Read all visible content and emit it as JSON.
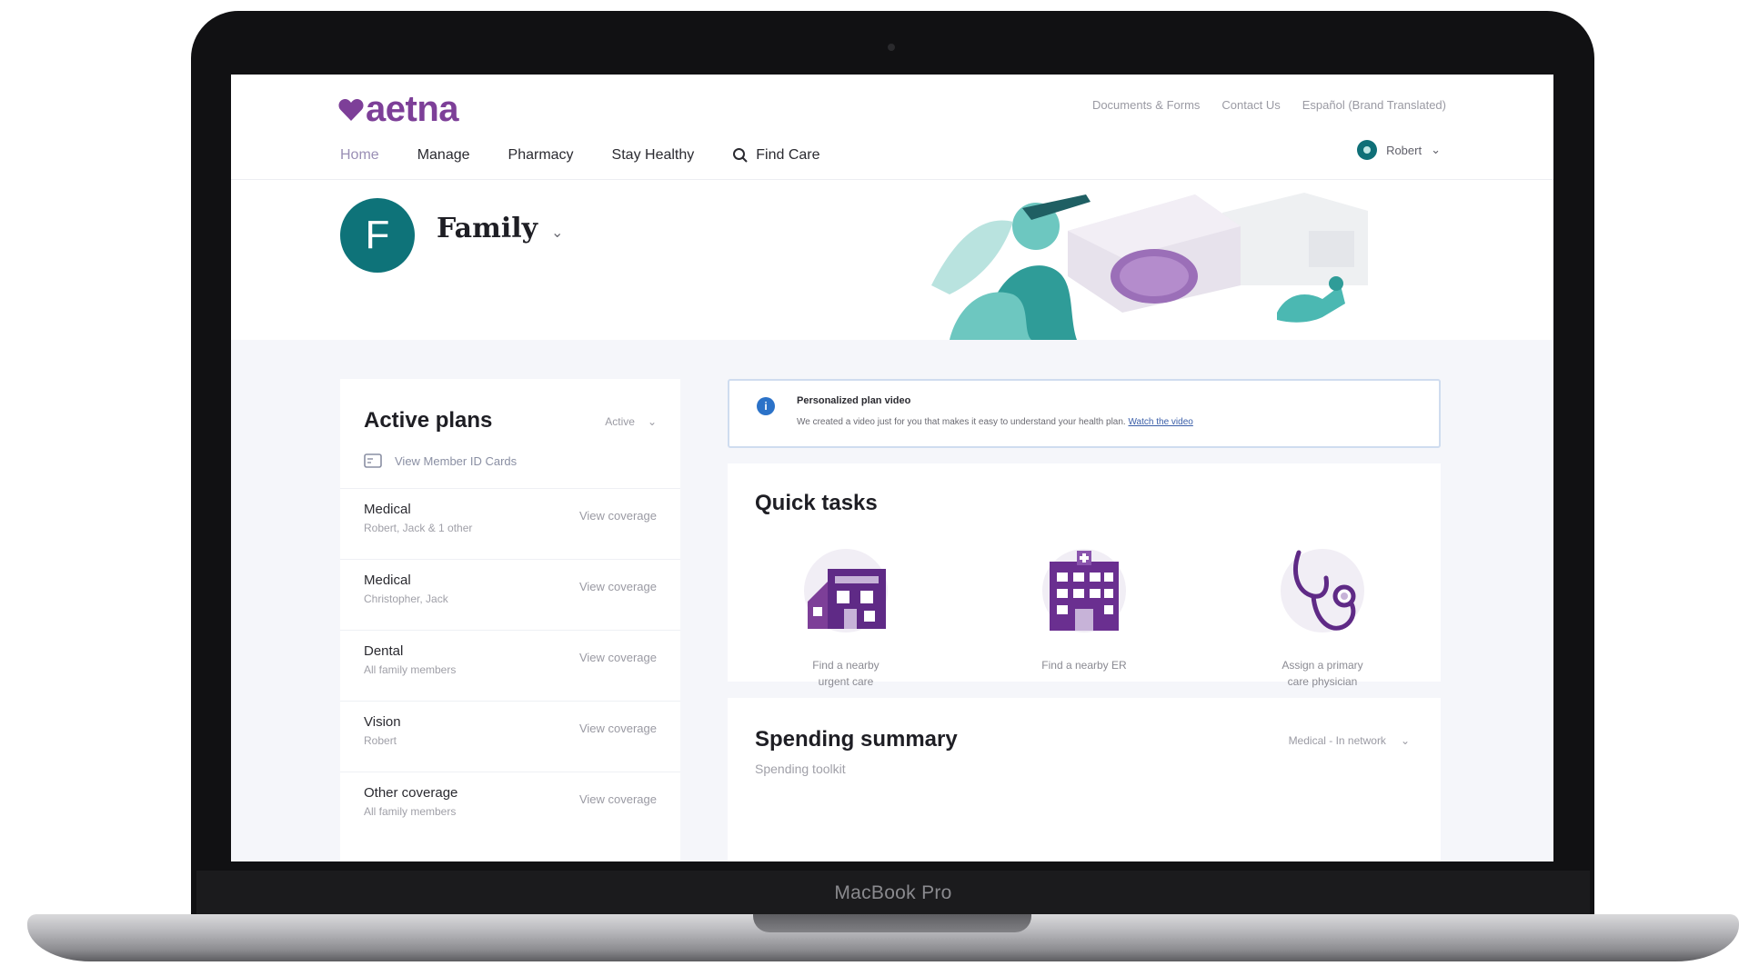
{
  "device": {
    "label": "MacBook Pro"
  },
  "header": {
    "logo_text": "aetna",
    "brand_color": "#7d3f98",
    "utility_links": [
      "Documents & Forms",
      "Contact Us",
      "Español (Brand Translated)"
    ],
    "nav": [
      {
        "label": "Home",
        "active": true
      },
      {
        "label": "Manage",
        "active": false
      },
      {
        "label": "Pharmacy",
        "active": false
      },
      {
        "label": "Stay Healthy",
        "active": false
      },
      {
        "label": "Find Care",
        "active": false,
        "icon": "search-icon"
      }
    ],
    "account_label": "Robert"
  },
  "hero": {
    "avatar_initial": "F",
    "avatar_color": "#0e7379",
    "member_name": "Family"
  },
  "plans": {
    "title": "Active plans",
    "filter_label": "Active",
    "id_cards_label": "View Member ID Cards",
    "items": [
      {
        "name": "Medical",
        "members": "Robert, Jack & 1 other",
        "link": "View coverage"
      },
      {
        "name": "Medical",
        "members": "Christopher, Jack",
        "link": "View coverage"
      },
      {
        "name": "Dental",
        "members": "All family members",
        "link": "View coverage"
      },
      {
        "name": "Vision",
        "members": "Robert",
        "link": "View coverage"
      },
      {
        "name": "Other coverage",
        "members": "All family members",
        "link": "View coverage"
      }
    ]
  },
  "notice": {
    "title": "Personalized plan video",
    "body": "We created a video just for you that makes it easy to understand your health plan.",
    "link": "Watch the video"
  },
  "tasks": {
    "title": "Quick tasks",
    "items": [
      {
        "label_line1": "Find a nearby",
        "label_line2": "urgent care",
        "icon": "urgent-care-icon"
      },
      {
        "label_line1": "Find a nearby ER",
        "label_line2": "",
        "icon": "hospital-icon"
      },
      {
        "label_line1": "Assign a primary",
        "label_line2": "care physician",
        "icon": "stethoscope-icon"
      }
    ]
  },
  "spending": {
    "title": "Spending summary",
    "subtitle": "Spending toolkit",
    "filter_label": "Medical - In network"
  }
}
